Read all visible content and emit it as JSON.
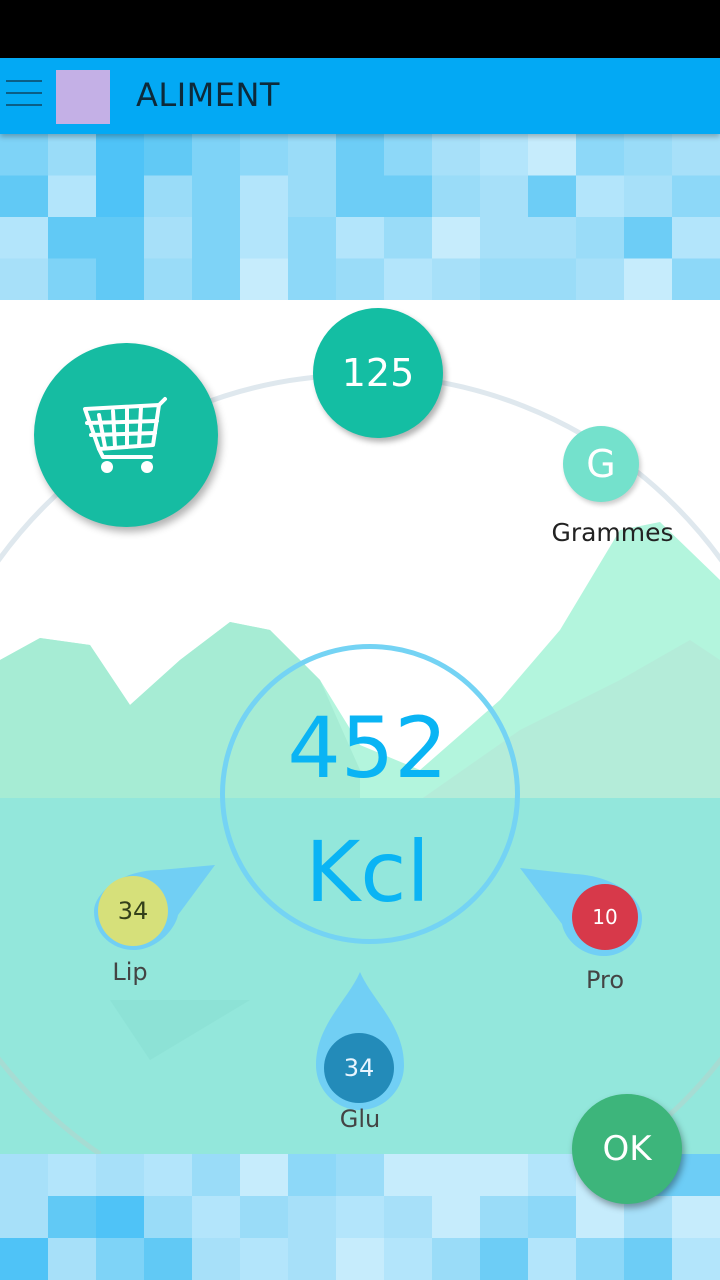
{
  "app_bar": {
    "title": "ALIMENT",
    "menu_icon": "hamburger-menu-icon",
    "app_icon_color": "#c4b0e6",
    "background_color": "#03a9f4"
  },
  "quantity": {
    "value": "125",
    "unit_letter": "G",
    "unit_label": "Grammes"
  },
  "cart": {
    "icon": "shopping-cart-icon"
  },
  "calories": {
    "value": "452",
    "unit": "Kcl"
  },
  "macros": {
    "lipids": {
      "value": "34",
      "label": "Lip",
      "color": "#d6e07a"
    },
    "proteins": {
      "value": "10",
      "label": "Pro",
      "color": "#d7394a"
    },
    "glucids": {
      "value": "34",
      "label": "Glu",
      "color": "#238bb9"
    }
  },
  "ok_button": {
    "label": "OK",
    "color": "#3db57b"
  },
  "colors": {
    "accent": "#14bea3",
    "calorie_text": "#0ab4f4"
  }
}
